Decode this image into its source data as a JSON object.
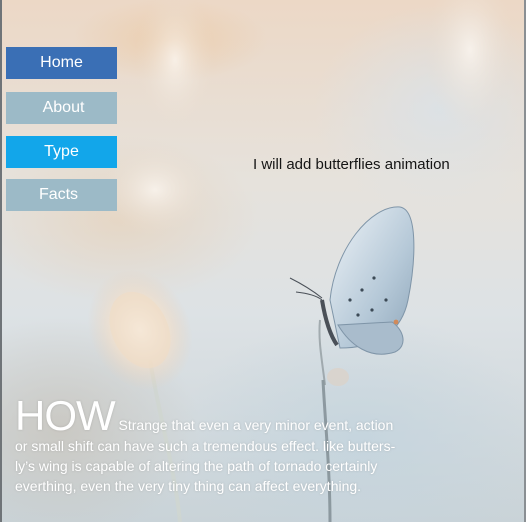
{
  "nav": {
    "items": [
      {
        "label": "Home"
      },
      {
        "label": "About"
      },
      {
        "label": "Type"
      },
      {
        "label": "Facts"
      }
    ],
    "colors": {
      "home": "#3a6fb5",
      "default": "#9cbac7",
      "type": "#12a6ea"
    }
  },
  "note": "I will add butterflies animation",
  "story": {
    "heading": "HOW",
    "lines": [
      "Strange that even a very minor event, action",
      "or small shift can have such a tremendous effect. like butters-",
      "ly’s wing is capable of altering the path of tornado certainly",
      "everthing, even the very tiny thing can affect everything."
    ]
  }
}
